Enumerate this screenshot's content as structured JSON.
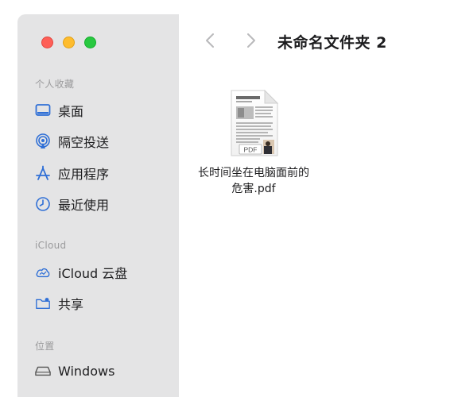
{
  "window": {
    "traffic_lights": {
      "close": "#fe5f57",
      "minimize": "#febc2e",
      "zoom": "#28c840"
    }
  },
  "toolbar": {
    "back_icon": "chevron-left",
    "forward_icon": "chevron-right",
    "folder_title": "未命名文件夹 2"
  },
  "sidebar": {
    "sections": [
      {
        "title": "个人收藏",
        "items": [
          {
            "label": "桌面",
            "icon": "desktop-icon"
          },
          {
            "label": "隔空投送",
            "icon": "airdrop-icon"
          },
          {
            "label": "应用程序",
            "icon": "applications-icon"
          },
          {
            "label": "最近使用",
            "icon": "clock-icon"
          }
        ]
      },
      {
        "title": "iCloud",
        "items": [
          {
            "label": "iCloud 云盘",
            "icon": "icloud-icon"
          },
          {
            "label": "共享",
            "icon": "shared-folder-icon"
          }
        ]
      },
      {
        "title": "位置",
        "items": [
          {
            "label": "Windows",
            "icon": "disk-icon"
          }
        ]
      }
    ]
  },
  "files": [
    {
      "name": "长时间坐在电脑面前的危害.pdf",
      "badge": "PDF",
      "icon": "pdf-document-icon"
    }
  ],
  "colors": {
    "sidebar_bg": "#e4e4e5",
    "accent": "#1a73e8",
    "icon_blue": "#2f6fd6"
  }
}
